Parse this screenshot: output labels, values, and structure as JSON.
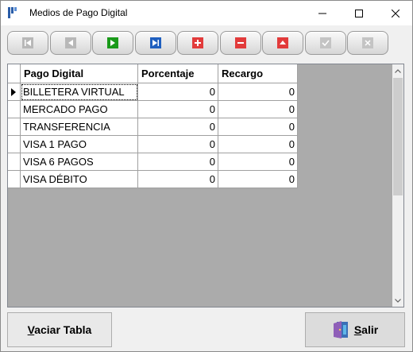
{
  "window": {
    "title": "Medios de Pago Digital"
  },
  "titlebar_controls": {
    "minimize": "minimize-icon",
    "maximize": "maximize-icon",
    "close": "close-icon"
  },
  "navigator": {
    "buttons": [
      {
        "name": "first",
        "icon": "first-record-icon"
      },
      {
        "name": "prior",
        "icon": "prior-record-icon"
      },
      {
        "name": "next",
        "icon": "next-record-icon"
      },
      {
        "name": "last",
        "icon": "last-record-icon"
      },
      {
        "name": "insert",
        "icon": "insert-icon"
      },
      {
        "name": "delete",
        "icon": "delete-icon"
      },
      {
        "name": "edit",
        "icon": "edit-icon"
      },
      {
        "name": "post",
        "icon": "post-icon"
      },
      {
        "name": "cancel",
        "icon": "cancel-icon"
      }
    ]
  },
  "grid": {
    "columns": [
      "Pago Digital",
      "Porcentaje",
      "Recargo"
    ],
    "rows": [
      {
        "pago": "BILLETERA VIRTUAL",
        "porcentaje": "0",
        "recargo": "0"
      },
      {
        "pago": "MERCADO PAGO",
        "porcentaje": "0",
        "recargo": "0"
      },
      {
        "pago": "TRANSFERENCIA",
        "porcentaje": "0",
        "recargo": "0"
      },
      {
        "pago": "VISA 1 PAGO",
        "porcentaje": "0",
        "recargo": "0"
      },
      {
        "pago": "VISA 6 PAGOS",
        "porcentaje": "0",
        "recargo": "0"
      },
      {
        "pago": "VISA DÉBITO",
        "porcentaje": "0",
        "recargo": "0"
      }
    ]
  },
  "footer": {
    "vaciar_accel": "V",
    "vaciar_rest": "aciar Tabla",
    "salir_accel": "S",
    "salir_rest": "alir"
  },
  "colors": {
    "next_green": "#1a9a1a",
    "last_blue": "#1f5fbf",
    "insert_red": "#e23b3b"
  }
}
